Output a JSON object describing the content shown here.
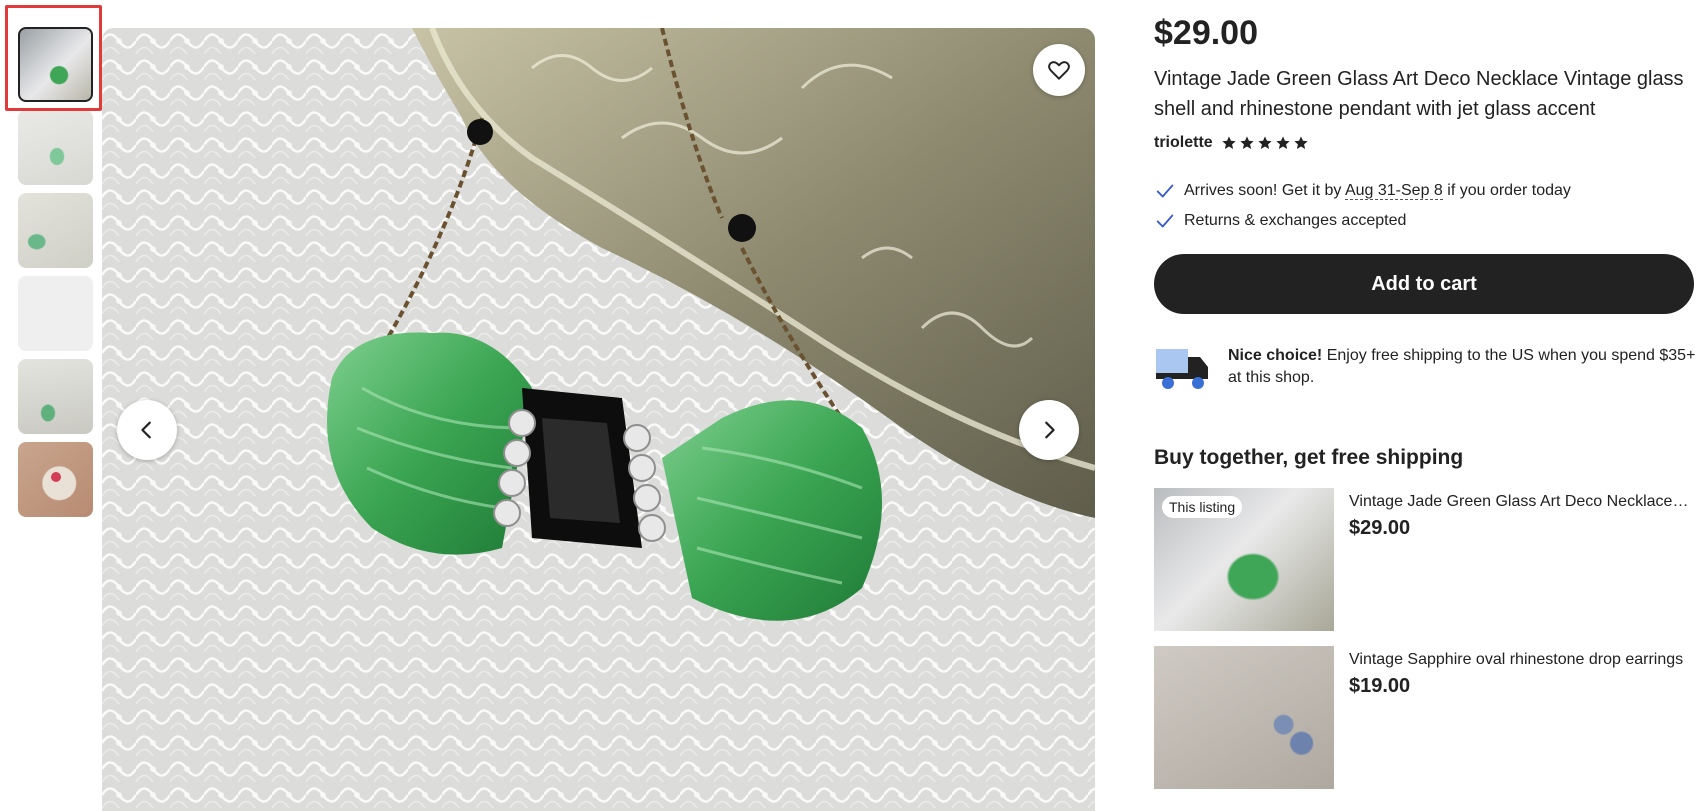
{
  "thumbnails": [
    {
      "name": "thumb-1"
    },
    {
      "name": "thumb-2"
    },
    {
      "name": "thumb-3"
    },
    {
      "name": "thumb-4"
    },
    {
      "name": "thumb-5"
    },
    {
      "name": "thumb-6"
    }
  ],
  "listing": {
    "price": "$29.00",
    "title": "Vintage Jade Green Glass Art Deco Necklace Vintage glass shell and rhinestone pendant with jet glass accent",
    "shop_name": "triolette",
    "rating_stars": 5
  },
  "features": {
    "arrives_prefix": "Arrives soon! Get it by",
    "arrives_dates": "Aug 31-Sep 8",
    "arrives_suffix": "if you order today",
    "returns": "Returns & exchanges accepted"
  },
  "cart": {
    "add_label": "Add to cart"
  },
  "shipping": {
    "bold": "Nice choice!",
    "text": "Enjoy free shipping to the US when you spend $35+ at this shop."
  },
  "buy_together": {
    "heading": "Buy together, get free shipping",
    "items": [
      {
        "badge": "This listing",
        "title": "Vintage Jade Green Glass Art Deco Necklace Vintage glass shell",
        "price": "$29.00"
      },
      {
        "badge": "",
        "title": "Vintage Sapphire oval rhinestone drop earrings",
        "price": "$19.00"
      }
    ]
  },
  "colors": {
    "accent_dark": "#222222",
    "check_blue": "#3a5bcc",
    "highlight_red": "#e03a3a"
  }
}
